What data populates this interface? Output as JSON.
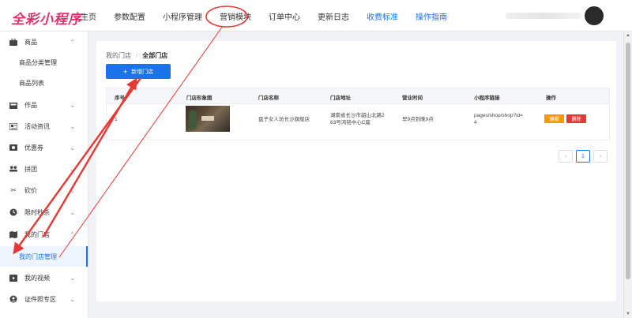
{
  "header": {
    "logo": "全彩小程序",
    "nav": [
      {
        "label": "主页",
        "style": "normal"
      },
      {
        "label": "参数配置",
        "style": "normal"
      },
      {
        "label": "小程序管理",
        "style": "normal"
      },
      {
        "label": "营销模块",
        "style": "normal"
      },
      {
        "label": "订单中心",
        "style": "normal"
      },
      {
        "label": "更新日志",
        "style": "normal"
      },
      {
        "label": "收费标准",
        "style": "link"
      },
      {
        "label": "操作指南",
        "style": "link"
      }
    ]
  },
  "sidebar": {
    "items": [
      {
        "icon": "briefcase-icon",
        "label": "商品",
        "chevron": "up"
      },
      {
        "icon": "",
        "label": "商品分类管理",
        "sub": true
      },
      {
        "icon": "",
        "label": "商品列表",
        "sub": true
      },
      {
        "icon": "gallery-icon",
        "label": "作品",
        "chevron": "down"
      },
      {
        "icon": "newspaper-icon",
        "label": "活动资讯",
        "chevron": "down"
      },
      {
        "icon": "coupon-icon",
        "label": "优惠券",
        "chevron": "down"
      },
      {
        "icon": "group-icon",
        "label": "拼团",
        "chevron": "down"
      },
      {
        "icon": "scissors-icon",
        "label": "砍价",
        "chevron": "down"
      },
      {
        "icon": "timer-icon",
        "label": "限时秒杀",
        "chevron": "down"
      },
      {
        "icon": "map-icon",
        "label": "我的门店",
        "chevron": "up"
      },
      {
        "icon": "",
        "label": "我的门店管理",
        "sub": true,
        "active": true
      },
      {
        "icon": "video-icon",
        "label": "我的视频",
        "chevron": "down"
      },
      {
        "icon": "id-card-icon",
        "label": "证件照专区",
        "chevron": "down"
      }
    ]
  },
  "main": {
    "breadcrumb": {
      "parent": "我的门店",
      "sep": "/",
      "current": "全部门店"
    },
    "add_button": "新增门店",
    "table": {
      "headers": [
        "序号",
        "门店形象图",
        "门店名称",
        "门店地址",
        "营业时间",
        "小程序链接",
        "操作"
      ],
      "rows": [
        {
          "index": "1",
          "name": "盘子女人坊长沙旗舰店",
          "address_line1": "湖南省长沙市韶山北路2",
          "address_line2": "63号鸿铭中心C座",
          "hours": "早9点到晚9点",
          "link_line1": "pages/shop/shop?id=",
          "link_line2": "4",
          "edit_label": "编辑",
          "delete_label": "删除"
        }
      ]
    },
    "pagination": {
      "prev": "‹",
      "current": "1",
      "next": "›"
    }
  },
  "colors": {
    "accent": "#1a73e8",
    "logo": "#e0306e",
    "edit": "#ff9900",
    "delete": "#e53935",
    "annotation": "#e53935"
  }
}
